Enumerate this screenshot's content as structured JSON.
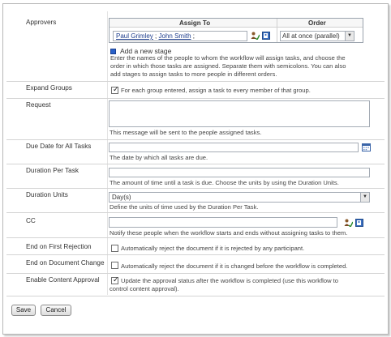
{
  "approvers": {
    "label": "Approvers",
    "col_assign_to": "Assign To",
    "col_order": "Order",
    "assignees": [
      "Paul Grimley",
      "John Smith"
    ],
    "separator": ";",
    "order_value": "All at once (parallel)",
    "add_stage": "Add a new stage",
    "description": [
      "Enter the names of the people to whom the workflow will assign tasks, and choose the",
      "order in which those tasks are assigned. Separate them with semicolons. You can also",
      "add stages to assign tasks to more people in different orders."
    ]
  },
  "expand_groups": {
    "label": "Expand Groups",
    "checked": true,
    "text": "For each group entered, assign a task to every member of that group."
  },
  "request": {
    "label": "Request",
    "value": "",
    "description": "This message will be sent to the people assigned tasks."
  },
  "due_date": {
    "label": "Due Date for All Tasks",
    "value": "",
    "description": "The date by which all tasks are due."
  },
  "duration_per_task": {
    "label": "Duration Per Task",
    "value": "",
    "description": "The amount of time until a task is due. Choose the units by using the Duration Units."
  },
  "duration_units": {
    "label": "Duration Units",
    "value": "Day(s)",
    "description": "Define the units of time used by the Duration Per Task."
  },
  "cc": {
    "label": "CC",
    "value": "",
    "description": "Notify these people when the workflow starts and ends without assigning tasks to them."
  },
  "end_first_rejection": {
    "label": "End on First Rejection",
    "checked": false,
    "text": "Automatically reject the document if it is rejected by any participant."
  },
  "end_doc_change": {
    "label": "End on Document Change",
    "checked": false,
    "text": "Automatically reject the document if it is changed before the workflow is completed."
  },
  "content_approval": {
    "label": "Enable Content Approval",
    "checked": true,
    "text": [
      "Update the approval status after the workflow is completed (use this workflow to",
      "control content approval)."
    ]
  },
  "buttons": {
    "save": "Save",
    "cancel": "Cancel"
  },
  "icons": {
    "people_picker": "check-names-icon",
    "address_book": "address-book-icon",
    "calendar": "calendar-icon",
    "add_stage": "add-stage-icon"
  }
}
